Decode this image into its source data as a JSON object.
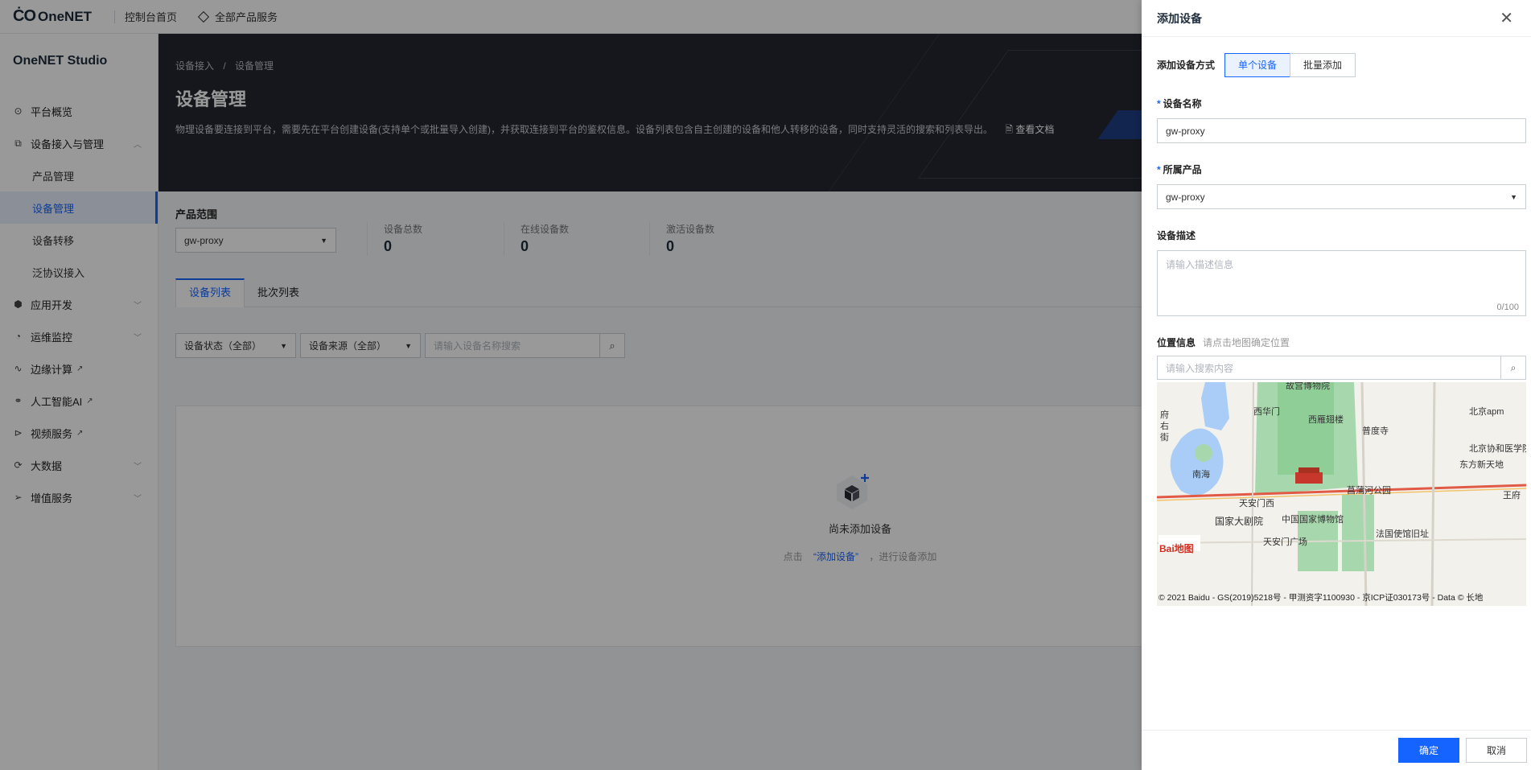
{
  "topbar": {
    "logo_mark": "ĊO",
    "logo_text": "OneNET",
    "console_home": "控制台首页",
    "all_products": "全部产品服务"
  },
  "sidebar": {
    "title": "OneNET Studio",
    "items": [
      {
        "label": "平台概览",
        "icon": "overview-icon",
        "glyph": "⊙"
      },
      {
        "label": "设备接入与管理",
        "icon": "device-access-icon",
        "glyph": "⧉",
        "chevron": "︿"
      },
      {
        "label": "应用开发",
        "icon": "app-dev-icon",
        "glyph": "⬢",
        "chevron": "﹀"
      },
      {
        "label": "运维监控",
        "icon": "monitor-icon",
        "glyph": "◔",
        "chevron": "﹀"
      },
      {
        "label": "边缘计算",
        "icon": "edge-icon",
        "glyph": "∿"
      },
      {
        "label": "人工智能AI",
        "icon": "ai-icon",
        "glyph": "⚭"
      },
      {
        "label": "视频服务",
        "icon": "video-icon",
        "glyph": "⊳"
      },
      {
        "label": "大数据",
        "icon": "bigdata-icon",
        "glyph": "⟳",
        "chevron": "﹀"
      },
      {
        "label": "增值服务",
        "icon": "value-added-icon",
        "glyph": "➢",
        "chevron": "﹀"
      }
    ],
    "sub_items": [
      "产品管理",
      "设备管理",
      "设备转移",
      "泛协议接入"
    ],
    "external_glyph": "↗"
  },
  "hero": {
    "breadcrumb_1": "设备接入",
    "breadcrumb_sep": "/",
    "breadcrumb_2": "设备管理",
    "title": "设备管理",
    "description": "物理设备要连接到平台，需要先在平台创建设备(支持单个或批量导入创建)，并获取连接到平台的鉴权信息。设备列表包含自主创建的设备和他人转移的设备，同时支持灵活的搜索和列表导出。",
    "doc_link": "🗎 查看文档"
  },
  "filters": {
    "scope_label": "产品范围",
    "scope_value": "gw-proxy",
    "stats": [
      {
        "label": "设备总数",
        "value": "0"
      },
      {
        "label": "在线设备数",
        "value": "0"
      },
      {
        "label": "激活设备数",
        "value": "0"
      }
    ]
  },
  "tabs": [
    "设备列表",
    "批次列表"
  ],
  "toolbar": {
    "status_select": "设备状态（全部）",
    "source_select": "设备来源（全部）",
    "search_placeholder": "请输入设备名称搜索",
    "search_glyph": "⌕"
  },
  "empty": {
    "title": "尚未添加设备",
    "tip_prefix": "点击",
    "tip_link": "“添加设备”",
    "tip_suffix": "，进行设备添加"
  },
  "drawer": {
    "title": "添加设备",
    "close_glyph": "✕",
    "method_label": "添加设备方式",
    "method_single": "单个设备",
    "method_batch": "批量添加",
    "req_mark": "*",
    "name_label": "设备名称",
    "name_value": "gw-proxy",
    "product_label": "所属产品",
    "product_value": "gw-proxy",
    "desc_label": "设备描述",
    "desc_placeholder": "请输入描述信息",
    "desc_count": "0/100",
    "location_label": "位置信息",
    "location_hint": "请点击地图确定位置",
    "location_search_placeholder": "请输入搜索内容",
    "map_labels": [
      "故宫博物院",
      "西华门",
      "西雁翅楼",
      "普度寺",
      "北京apm",
      "北京协和医学院",
      "东方新天地",
      "南海",
      "府右街",
      "天安门西",
      "菖蒲河公园",
      "王府",
      "国家大剧院",
      "中国国家博物馆",
      "天安门广场",
      "法国使馆旧址"
    ],
    "map_logo": "Bai地图",
    "map_copyright": "© 2021 Baidu - GS(2019)5218号 - 甲测资字1100930 - 京ICP证030173号 - Data © 长地",
    "confirm": "确定",
    "cancel": "取消"
  },
  "colors": {
    "accent": "#1664ff",
    "hero_bg": "#23272f",
    "mask": "rgba(0,0,0,0.40)"
  }
}
